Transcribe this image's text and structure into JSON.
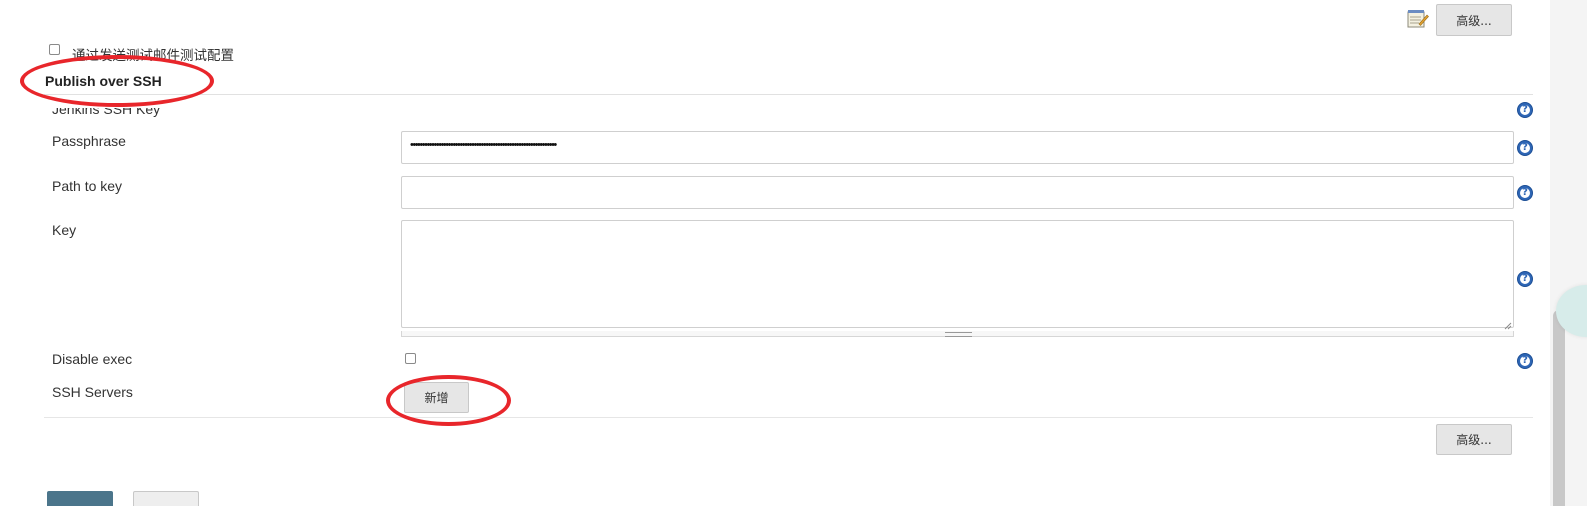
{
  "top_advanced_button": "高级...",
  "test_email_checkbox_label": "通过发送测试邮件测试配置",
  "section_title": "Publish over SSH",
  "jenkins_ssh_key_label": "Jenkins SSH Key",
  "passphrase": {
    "label": "Passphrase",
    "value": "••••••••••••••••••••••••••••••••••••••••••••••••••••••••••••••"
  },
  "path_to_key": {
    "label": "Path to key",
    "value": ""
  },
  "key": {
    "label": "Key",
    "value": ""
  },
  "disable_exec": {
    "label": "Disable exec",
    "checked": false
  },
  "ssh_servers": {
    "label": "SSH Servers",
    "add_button": "新增"
  },
  "bottom_advanced_button": "高级...",
  "help_icon_glyph": "?",
  "colors": {
    "annotation_red": "#e8262b",
    "save_button": "#4b758b",
    "help_icon": "#2e66b5"
  }
}
